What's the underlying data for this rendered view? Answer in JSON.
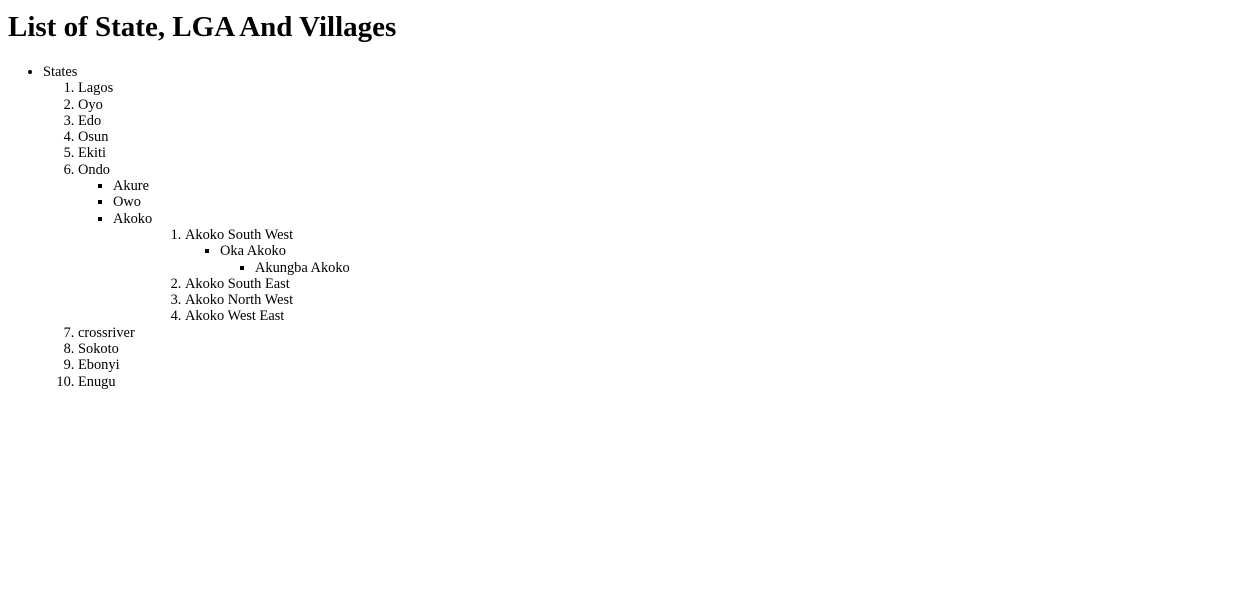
{
  "title": "List of State, LGA And Villages",
  "root_label": "States",
  "states": [
    "Lagos",
    "Oyo",
    "Edo",
    "Osun",
    "Ekiti",
    "Ondo",
    "crossriver",
    "Sokoto",
    "Ebonyi",
    "Enugu"
  ],
  "ondo_towns": [
    "Akure",
    "Owo",
    "Akoko"
  ],
  "akoko_lgas": [
    "Akoko South West",
    "Akoko South East",
    "Akoko North West",
    "Akoko West East"
  ],
  "akoko_sw_towns": [
    "Oka Akoko"
  ],
  "oka_akoko_villages": [
    "Akungba Akoko"
  ]
}
